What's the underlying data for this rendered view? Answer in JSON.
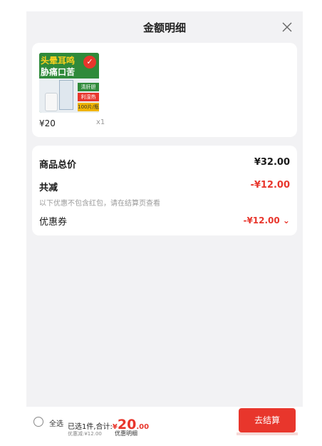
{
  "header": {
    "title": "金额明细",
    "close_icon": "close-icon"
  },
  "product": {
    "image": {
      "line1": "头晕耳鸣",
      "line2": "胁痛口苦",
      "stamp": "✓",
      "tags": [
        "清肝胆",
        "利湿热",
        "100片/瓶"
      ]
    },
    "price": "¥20",
    "quantity": "x1"
  },
  "summary": {
    "total_label": "商品总价",
    "total_value": "¥32.00",
    "reduce_label": "共减",
    "reduce_value": "-¥12.00",
    "note": "以下优惠不包含红包，请在结算页查看",
    "coupon_label": "优惠券",
    "coupon_value": "-¥12.00 ⌄"
  },
  "footer": {
    "select_all": "全选",
    "selected_text": "已选1件,合计:",
    "yen": "¥",
    "total_int": "20",
    "total_dec": ".00",
    "discount": "优惠减:¥12.00",
    "detail_link": "优惠明细",
    "checkout": "去结算"
  },
  "colors": {
    "accent": "#e8362c",
    "background": "#f2f2f4",
    "card": "#ffffff"
  }
}
